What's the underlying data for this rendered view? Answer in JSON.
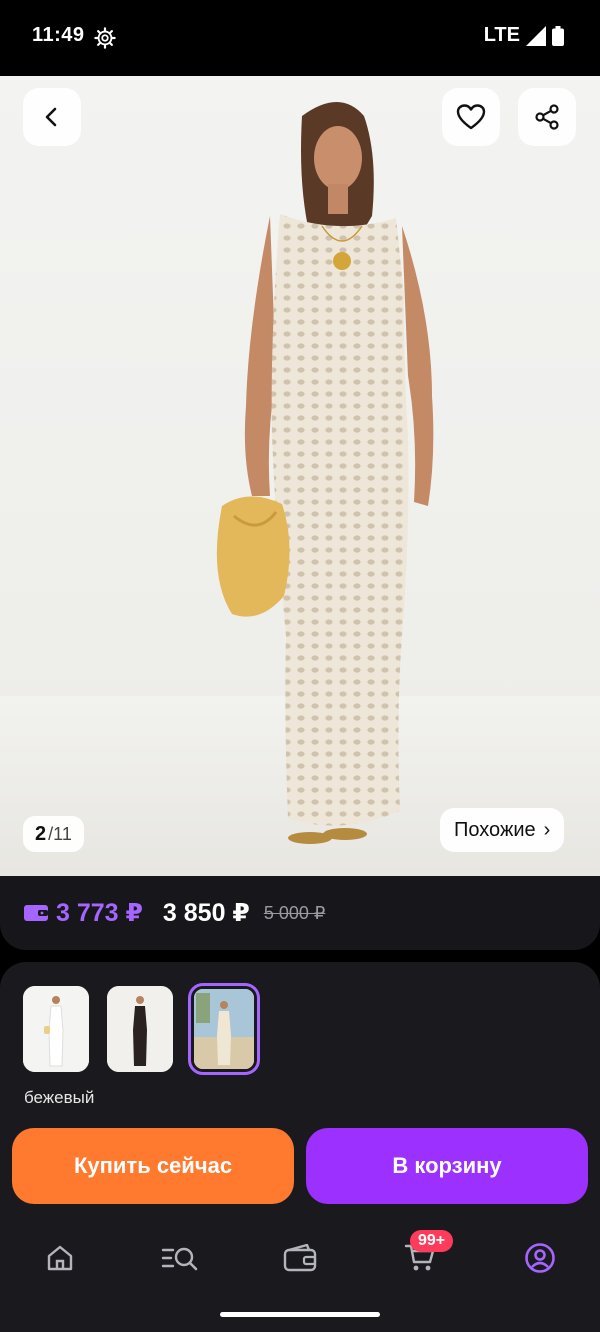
{
  "status_bar": {
    "time": "11:49",
    "network": "LTE",
    "icons": [
      "gear-icon",
      "signal-icon",
      "battery-icon"
    ]
  },
  "gallery": {
    "current": "2",
    "separator": "/",
    "total": "11",
    "similar_label": "Похожие",
    "similar_chevron": "›"
  },
  "price": {
    "wallet_price": "3 773 ₽",
    "current_price": "3 850 ₽",
    "old_price": "5 000 ₽",
    "wallet_color": "#a466ff"
  },
  "variants": {
    "selected_color_name": "бежевый",
    "thumbnails": [
      "white-dress",
      "black-dress",
      "beige-dress-beach"
    ],
    "selected_index": 2
  },
  "actions": {
    "buy_now": "Купить сейчас",
    "add_to_cart": "В корзину",
    "buy_color": "#ff7a2e",
    "cart_color": "#9b30ff"
  },
  "nav": {
    "items": [
      "home-icon",
      "catalog-search-icon",
      "wallet-icon",
      "cart-icon",
      "profile-icon"
    ],
    "cart_badge": "99+",
    "active_index": 4,
    "active_color": "#a466ff"
  }
}
